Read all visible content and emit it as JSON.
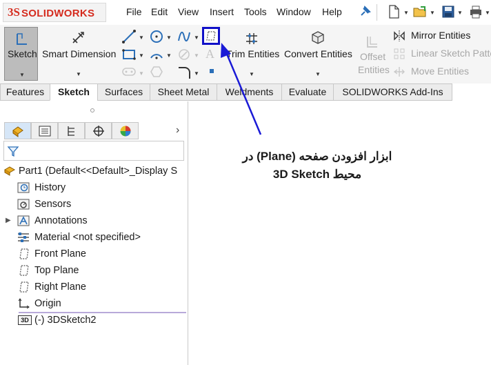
{
  "app": {
    "logo_prefix": "3S",
    "logo_text": "SOLIDWORKS",
    "menu": [
      "File",
      "Edit",
      "View",
      "Insert",
      "Tools",
      "Window",
      "Help"
    ]
  },
  "commands": {
    "sketch": "Sketch",
    "smart_dimension": "Smart Dimension",
    "trim_entities": "Trim Entities",
    "convert_entities": "Convert Entities",
    "offset_entities_line1": "Offset",
    "offset_entities_line2": "Entities",
    "mirror_entities": "Mirror Entities",
    "linear_sketch_pattern": "Linear Sketch Patte",
    "move_entities": "Move Entities"
  },
  "tabs": [
    "Features",
    "Sketch",
    "Surfaces",
    "Sheet Metal",
    "Weldments",
    "Evaluate",
    "SOLIDWORKS Add-Ins"
  ],
  "active_tab": "Sketch",
  "tree": {
    "part": "Part1  (Default<<Default>_Display S",
    "items": [
      {
        "label": "History",
        "icon": "history-icon"
      },
      {
        "label": "Sensors",
        "icon": "sensors-icon"
      },
      {
        "label": "Annotations",
        "icon": "annotations-icon"
      },
      {
        "label": "Material <not specified>",
        "icon": "material-icon"
      },
      {
        "label": "Front Plane",
        "icon": "plane-icon"
      },
      {
        "label": "Top Plane",
        "icon": "plane-icon"
      },
      {
        "label": "Right Plane",
        "icon": "plane-icon"
      },
      {
        "label": "Origin",
        "icon": "origin-icon"
      },
      {
        "label": "(-) 3DSketch2",
        "icon": "3d-sketch-icon"
      }
    ],
    "sketch_icon_text": "3D"
  },
  "annotation": {
    "line1": "ابزار افزودن صفحه (Plane) در",
    "line2": "محیط 3D Sketch"
  },
  "colors": {
    "brand_red": "#d52b1e",
    "highlight_blue": "#1010c8",
    "arrow_blue": "#1a1ad6"
  }
}
